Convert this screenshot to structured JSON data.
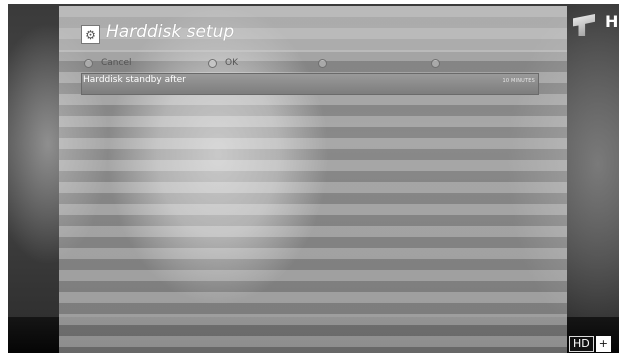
{
  "window": {
    "title": "Harddisk setup",
    "title_icon": "settings-gear-icon"
  },
  "color_keys": [
    {
      "color": "red",
      "label": "Cancel"
    },
    {
      "color": "green",
      "label": "OK"
    },
    {
      "color": "yellow",
      "label": ""
    },
    {
      "color": "blue",
      "label": ""
    }
  ],
  "menu": {
    "items": [
      {
        "label": "Harddisk standby after",
        "value": "10 MINUTES",
        "selected": true
      }
    ]
  },
  "channel": {
    "logo_text": "H"
  },
  "badge": {
    "hd": "HD",
    "suffix": "+"
  }
}
